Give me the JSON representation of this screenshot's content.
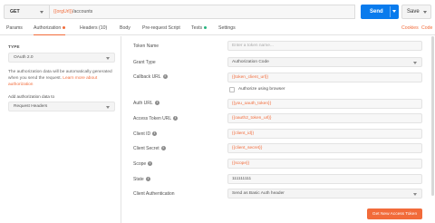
{
  "request": {
    "method": "GET",
    "url_var": "{{orgUrl}}",
    "url_path": "/accounts",
    "send_label": "Send",
    "save_label": "Save"
  },
  "tabs": [
    {
      "label": "Params"
    },
    {
      "label": "Authorization"
    },
    {
      "label": "Headers (10)"
    },
    {
      "label": "Body"
    },
    {
      "label": "Pre-request Script"
    },
    {
      "label": "Tests"
    },
    {
      "label": "Settings"
    }
  ],
  "tab_links": {
    "cookies": "Cookies",
    "code": "Code"
  },
  "left_panel": {
    "type_label": "TYPE",
    "type_value": "OAuth 2.0",
    "info_text": "The authorization data will be automatically generated when you send the request. ",
    "learn_more": "Learn more about authorization",
    "add_to_label": "Add authorization data to",
    "add_to_value": "Request Headers"
  },
  "form": {
    "token_name": {
      "label": "Token Name",
      "placeholder": "Enter a token name..."
    },
    "grant_type": {
      "label": "Grant Type",
      "value": "Authorization Code"
    },
    "callback_url": {
      "label": "Callback URL",
      "value": "{{token_client_url}}"
    },
    "authorize_browser": {
      "label": "Authorize using browser"
    },
    "auth_url": {
      "label": "Auth URL",
      "value": "{{you_oauth_token}}"
    },
    "access_token_url": {
      "label": "Access Token URL",
      "value": "{{oauth2_token_url}}"
    },
    "client_id": {
      "label": "Client ID",
      "value": "{{client_id}}"
    },
    "client_secret": {
      "label": "Client Secret",
      "value": "{{client_secret}}"
    },
    "scope": {
      "label": "Scope",
      "value": "{{scope}}"
    },
    "state": {
      "label": "State",
      "value": "111111111"
    },
    "client_authentication": {
      "label": "Client Authentication",
      "value": "Send as Basic Auth header"
    },
    "get_token_button": "Get New Access Token"
  },
  "colors": {
    "accent": "#f26b3a",
    "send": "#097bed",
    "tests_dot": "#26b47f"
  }
}
